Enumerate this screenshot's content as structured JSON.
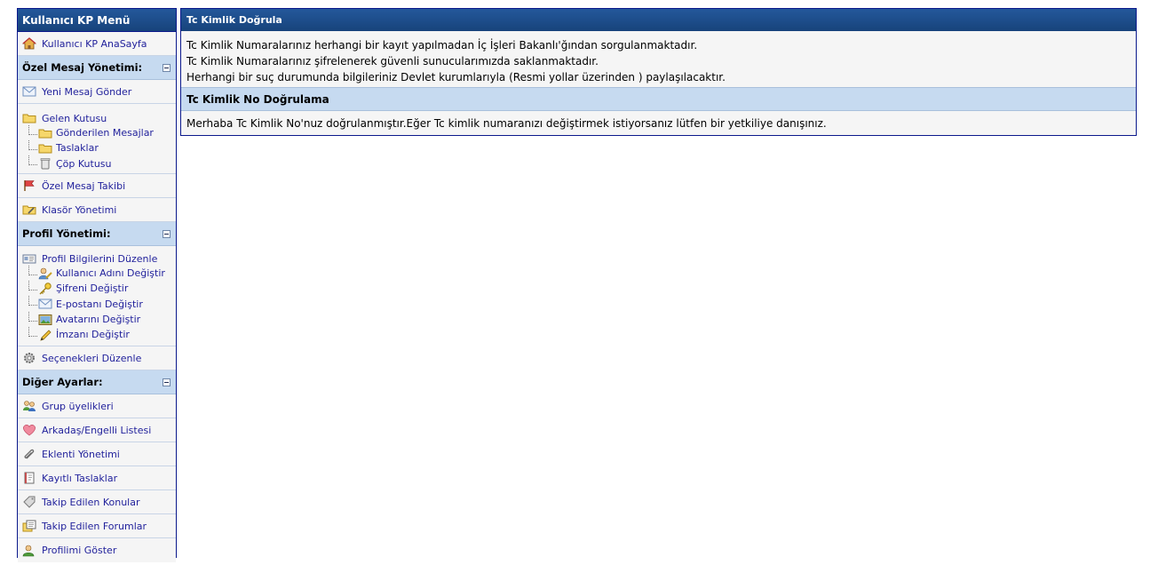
{
  "sidebar": {
    "title": "Kullanıcı KP Menü",
    "home": {
      "label": "Kullanıcı KP AnaSayfa",
      "icon": "home-icon"
    },
    "pm": {
      "header": "Özel Mesaj Yönetimi:",
      "send": "Yeni Mesaj Gönder",
      "inbox": "Gelen Kutusu",
      "sent": "Gönderilen Mesajlar",
      "drafts": "Taslaklar",
      "trash": "Çöp Kutusu",
      "tracking": "Özel Mesaj Takibi",
      "folders": "Klasör Yönetimi"
    },
    "profile": {
      "header": "Profil Yönetimi:",
      "edit": "Profil Bilgilerini Düzenle",
      "username": "Kullanıcı Adını Değiştir",
      "password": "Şifreni Değiştir",
      "email": "E-postanı Değiştir",
      "avatar": "Avatarını Değiştir",
      "signature": "İmzanı Değiştir",
      "options": "Seçenekleri Düzenle"
    },
    "misc": {
      "header": "Diğer Ayarlar:",
      "groups": "Grup üyelikleri",
      "buddies": "Arkadaş/Engelli Listesi",
      "attachments": "Eklenti Yönetimi",
      "saved_drafts": "Kayıtlı Taslaklar",
      "subscribed_threads": "Takip Edilen Konular",
      "subscribed_forums": "Takip Edilen Forumlar",
      "view_profile": "Profilimi Göster"
    }
  },
  "main": {
    "title": "Tc Kimlik Doğrula",
    "lines": [
      "Tc Kimlik Numaralarınız herhangi bir kayıt yapılmadan İç İşleri Bakanlı'ğından sorgulanmaktadır.",
      "Tc Kimlik Numaralarınız şifrelenerek güvenli sunucularımızda saklanmaktadır.",
      "Herhangi bir suç durumunda bilgileriniz Devlet kurumlarıyla (Resmi yollar üzerinden ) paylaşılacaktır."
    ],
    "subtitle": "Tc Kimlik No Doğrulama",
    "message": "Merhaba Tc Kimlik No'nuz doğrulanmıştır.Eğer Tc kimlik numaranızı değiştirmek istiyorsanız lütfen bir yetkiliye danışınız."
  }
}
